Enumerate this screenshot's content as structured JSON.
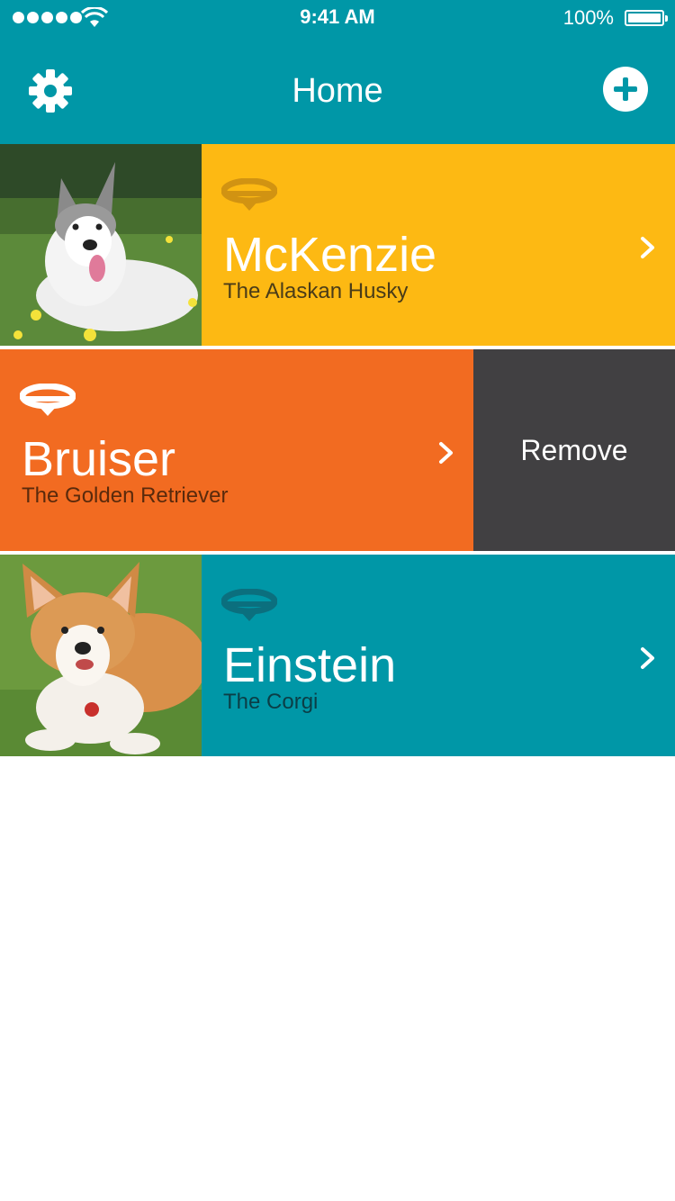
{
  "status_bar": {
    "time": "9:41 AM",
    "battery_percent": "100%",
    "battery_level": 1.0
  },
  "nav": {
    "title": "Home",
    "settings_icon": "gear-icon",
    "add_icon": "plus-circle-icon"
  },
  "pets": [
    {
      "name": "McKenzie",
      "breed": "The Alaskan Husky",
      "color": "#fdb913",
      "collar_color": "#d19312",
      "photo": "husky-photo"
    },
    {
      "name": "Bruiser",
      "breed": "The Golden Retriever",
      "color": "#f26b21",
      "collar_color": "#ffffff"
    },
    {
      "name": "Einstein",
      "breed": "The Corgi",
      "color": "#0097a7",
      "collar_color": "#0b6f7e",
      "photo": "corgi-photo"
    }
  ],
  "swipe_action": {
    "label": "Remove",
    "color": "#414042"
  },
  "colors": {
    "header": "#0097a7",
    "accent_yellow": "#fdb913",
    "accent_orange": "#f26b21",
    "accent_teal": "#0097a7",
    "remove_gray": "#414042"
  }
}
